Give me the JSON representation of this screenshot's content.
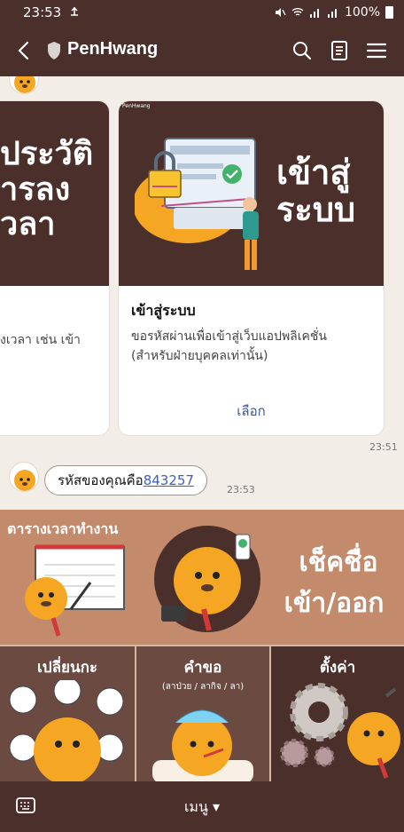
{
  "status_bar": {
    "time": "23:53",
    "battery": "100%",
    "icons": [
      "usb-icon",
      "mute-icon",
      "wifi-icon",
      "signal-icon",
      "battery-icon"
    ]
  },
  "header": {
    "title": "PenHwang",
    "icons": [
      "back-icon",
      "shield-icon",
      "search-icon",
      "notes-icon",
      "menu-icon"
    ]
  },
  "carousel": {
    "card_left": {
      "hero_text": [
        "ประวัติ",
        "ารลง",
        "วลา"
      ],
      "desc_fragment": "งเวลา เช่น เข้า"
    },
    "card_main": {
      "brand_tag": "PenHwang",
      "hero_text": [
        "เข้าสู่",
        "ระบบ"
      ],
      "title": "เข้าสู่ระบบ",
      "description": "ขอรหัสผ่านเพื่อเข้าสู่เว็บแอปพลิเคชั่น (สำหรับฝ่ายบุคคลเท่านั้น)",
      "action": "เลือก"
    },
    "timestamp": "23:51"
  },
  "message": {
    "prefix": "รหัสของคุณคือ",
    "code": "843257",
    "timestamp": "23:53"
  },
  "rich_menu": {
    "tiles": [
      {
        "label": "ตารางเวลาทำงาน"
      },
      {
        "label_line1": "เช็คชื่อ",
        "label_line2": "เข้า/ออก"
      },
      {
        "label": "เปลี่ยนกะ"
      },
      {
        "label": "คำขอ",
        "sublabel": "(ลาป่วย / ลากิจ / ลา)"
      },
      {
        "label": "ตั้งค่า"
      }
    ]
  },
  "bottom_bar": {
    "menu_label": "เมนู ▾"
  },
  "colors": {
    "brand_brown": "#4a2f2a",
    "menu_tan": "#c48a6c",
    "accent_orange": "#f5a623",
    "link_blue": "#3b5fc4"
  }
}
